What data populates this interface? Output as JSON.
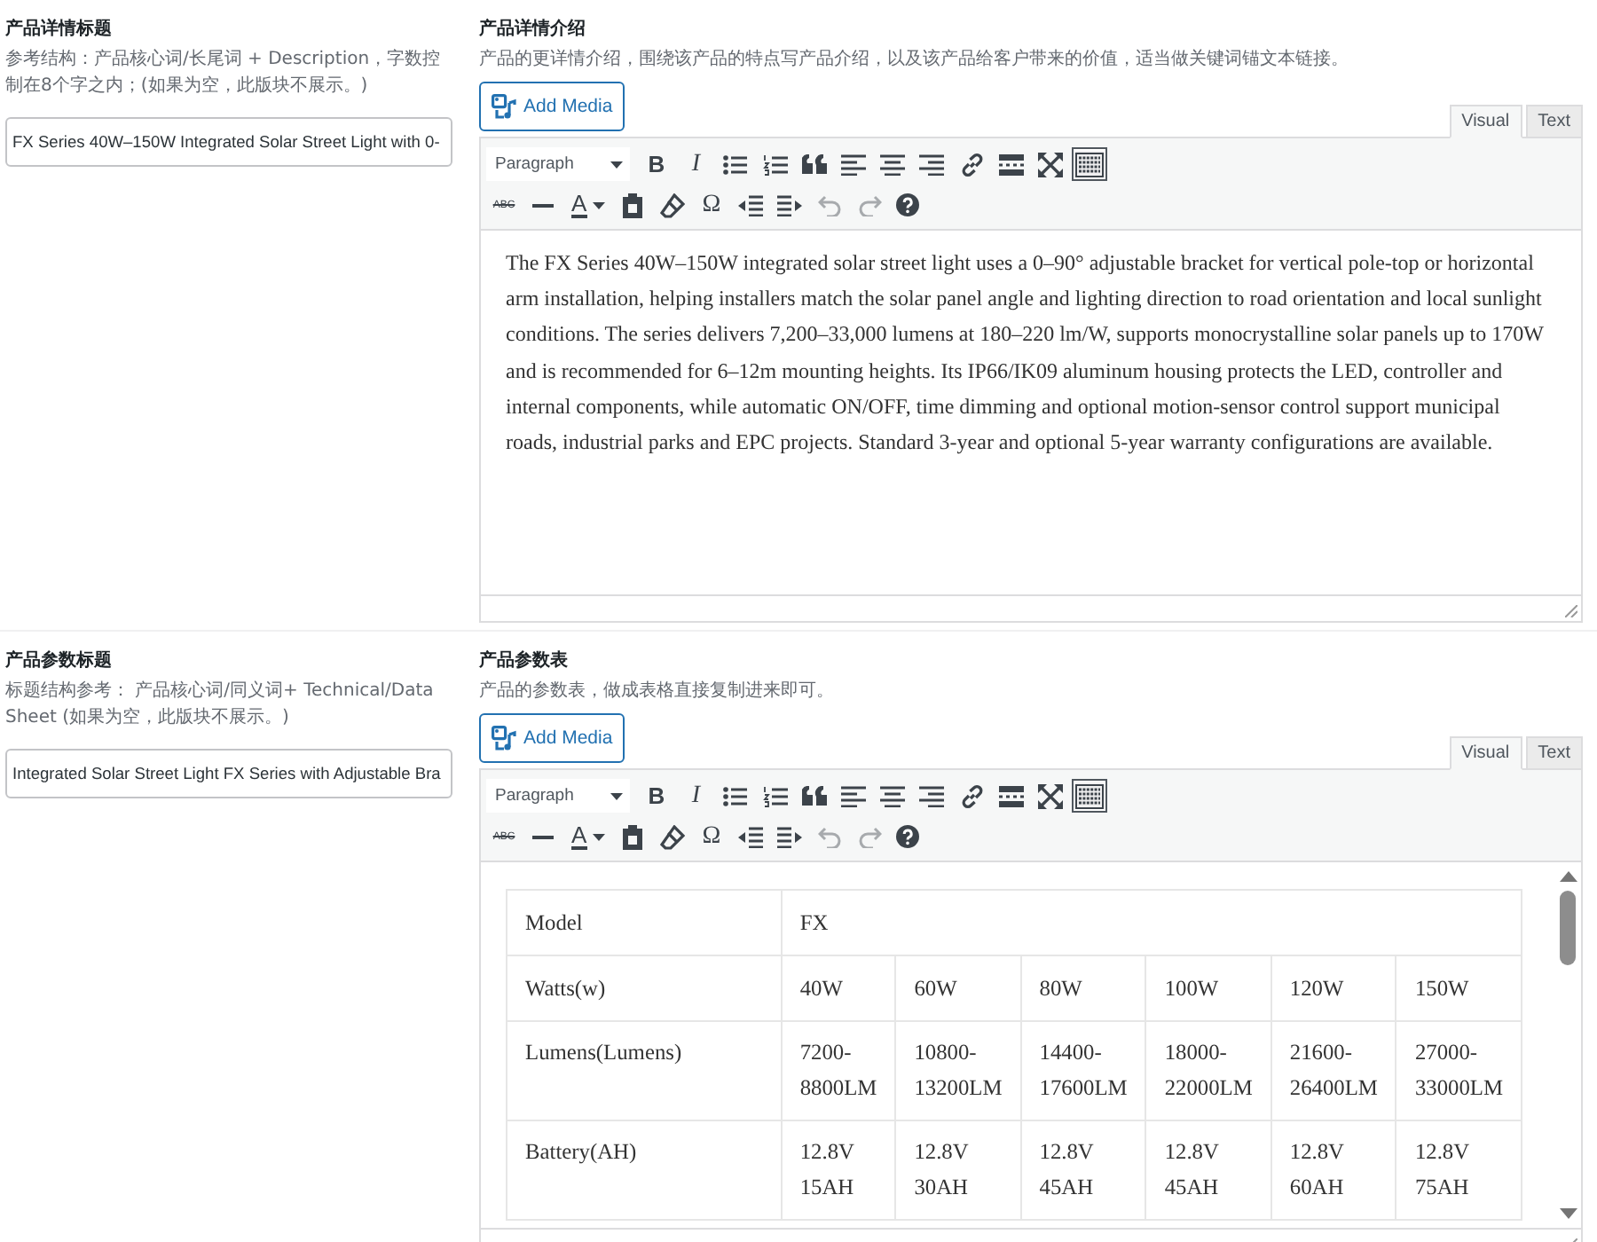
{
  "sections": [
    {
      "title_field": {
        "label": "产品详情标题",
        "hint": "参考结构：产品核心词/长尾词 + Description，字数控制在8个字之内；(如果为空，此版块不展示。)",
        "value": "FX Series 40W–150W Integrated Solar Street Light with 0-"
      },
      "editor": {
        "label": "产品详情介绍",
        "hint": "产品的更详情介绍，围绕该产品的特点写产品介绍，以及该产品给客户带来的价值，适当做关键词锚文本链接。",
        "media_button": "Add Media",
        "tabs": [
          {
            "label": "Visual",
            "selected": true
          },
          {
            "label": "Text",
            "selected": false
          }
        ],
        "format": "Paragraph",
        "toolbar": {
          "bold": "B",
          "italic": "I",
          "strikethrough": "ABC",
          "text_color": "A",
          "special_character": "Ω",
          "kitchen_sink_on": true,
          "undo_disabled": true,
          "redo_disabled": true
        },
        "content": {
          "kind": "paragraph",
          "text": "The FX Series 40W–150W integrated solar street light uses a 0–90° adjustable bracket for vertical pole-top or horizontal arm installation, helping installers match the solar panel angle and lighting direction to road orientation and local sunlight conditions. The series delivers 7,200–33,000 lumens at 180–220 lm/W, supports monocrystalline solar panels up to 170W and is recommended for 6–12m mounting heights. Its IP66/IK09 aluminum housing protects the LED, controller and internal components, while automatic ON/OFF, time dimming and optional motion-sensor control support municipal roads, industrial parks and EPC projects. Standard 3-year and optional 5-year warranty configurations are available."
        }
      }
    },
    {
      "title_field": {
        "label": "产品参数标题",
        "hint": "标题结构参考： 产品核心词/同义词+ Technical/Data Sheet (如果为空，此版块不展示。)",
        "value": "Integrated Solar Street Light FX Series with Adjustable Bra"
      },
      "editor": {
        "label": "产品参数表",
        "hint": "产品的参数表，做成表格直接复制进来即可。",
        "media_button": "Add Media",
        "tabs": [
          {
            "label": "Visual",
            "selected": true
          },
          {
            "label": "Text",
            "selected": false
          }
        ],
        "format": "Paragraph",
        "toolbar": {
          "bold": "B",
          "italic": "I",
          "strikethrough": "ABC",
          "text_color": "A",
          "special_character": "Ω",
          "kitchen_sink_on": true,
          "undo_disabled": true,
          "redo_disabled": true
        },
        "content": {
          "kind": "table",
          "rows": [
            [
              {
                "text": "Model"
              },
              {
                "text": "FX",
                "colspan": 6
              }
            ],
            [
              {
                "text": "Watts(w)"
              },
              {
                "text": "40W"
              },
              {
                "text": "60W"
              },
              {
                "text": "80W"
              },
              {
                "text": "100W"
              },
              {
                "text": "120W"
              },
              {
                "text": "150W"
              }
            ],
            [
              {
                "text": "Lumens(Lumens)"
              },
              {
                "text": "7200-8800LM"
              },
              {
                "text": "10800-13200LM"
              },
              {
                "text": "14400-17600LM"
              },
              {
                "text": "18000-22000LM"
              },
              {
                "text": "21600-26400LM"
              },
              {
                "text": "27000-33000LM"
              }
            ],
            [
              {
                "text": "Battery(AH)"
              },
              {
                "text": "12.8V 15AH"
              },
              {
                "text": "12.8V 30AH"
              },
              {
                "text": "12.8V 45AH"
              },
              {
                "text": "12.8V 45AH"
              },
              {
                "text": "12.8V 60AH"
              },
              {
                "text": "12.8V 75AH"
              }
            ]
          ]
        }
      }
    }
  ]
}
